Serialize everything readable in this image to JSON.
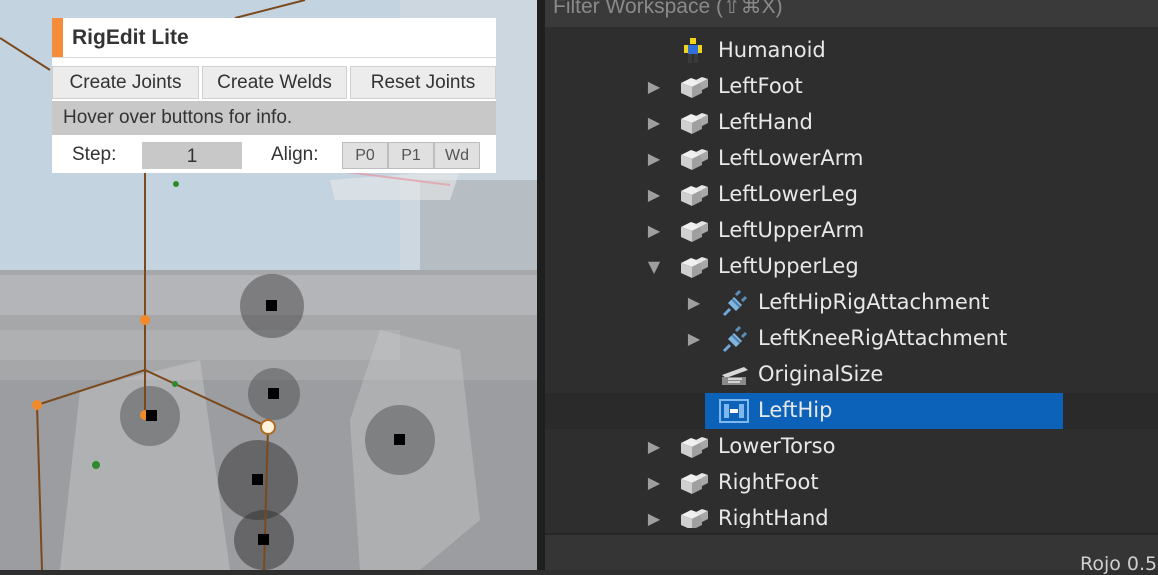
{
  "rigedit": {
    "title": "RigEdit Lite",
    "buttons": [
      "Create Joints",
      "Create Welds",
      "Reset Joints"
    ],
    "info": "Hover over buttons for info.",
    "step_label": "Step:",
    "step_value": "1",
    "align_label": "Align:",
    "align_buttons": [
      "P0",
      "P1",
      "Wd"
    ],
    "accent_color": "#f58c3a"
  },
  "explorer": {
    "filter_placeholder": "Filter Workspace (⇧⌘X)",
    "selected_color": "#0b62b8",
    "tree": [
      {
        "label": "Humanoid",
        "icon": "humanoid-icon",
        "expander": "none",
        "level": 1
      },
      {
        "label": "LeftFoot",
        "icon": "meshpart-icon",
        "expander": "collapsed",
        "level": 1
      },
      {
        "label": "LeftHand",
        "icon": "meshpart-icon",
        "expander": "collapsed",
        "level": 1
      },
      {
        "label": "LeftLowerArm",
        "icon": "meshpart-icon",
        "expander": "collapsed",
        "level": 1
      },
      {
        "label": "LeftLowerLeg",
        "icon": "meshpart-icon",
        "expander": "collapsed",
        "level": 1
      },
      {
        "label": "LeftUpperArm",
        "icon": "meshpart-icon",
        "expander": "collapsed",
        "level": 1
      },
      {
        "label": "LeftUpperLeg",
        "icon": "meshpart-icon",
        "expander": "expanded",
        "level": 1
      },
      {
        "label": "LeftHipRigAttachment",
        "icon": "attachment-icon",
        "expander": "collapsed",
        "level": 2
      },
      {
        "label": "LeftKneeRigAttachment",
        "icon": "attachment-icon",
        "expander": "collapsed",
        "level": 2
      },
      {
        "label": "OriginalSize",
        "icon": "vector3value-icon",
        "expander": "none",
        "level": 2
      },
      {
        "label": "LeftHip",
        "icon": "motor6d-icon",
        "expander": "none",
        "level": 2,
        "selected": true
      },
      {
        "label": "LowerTorso",
        "icon": "meshpart-icon",
        "expander": "collapsed",
        "level": 1
      },
      {
        "label": "RightFoot",
        "icon": "meshpart-icon",
        "expander": "collapsed",
        "level": 1
      },
      {
        "label": "RightHand",
        "icon": "meshpart-icon",
        "expander": "collapsed",
        "level": 1
      }
    ]
  },
  "status": {
    "text": "Rojo 0.5"
  }
}
